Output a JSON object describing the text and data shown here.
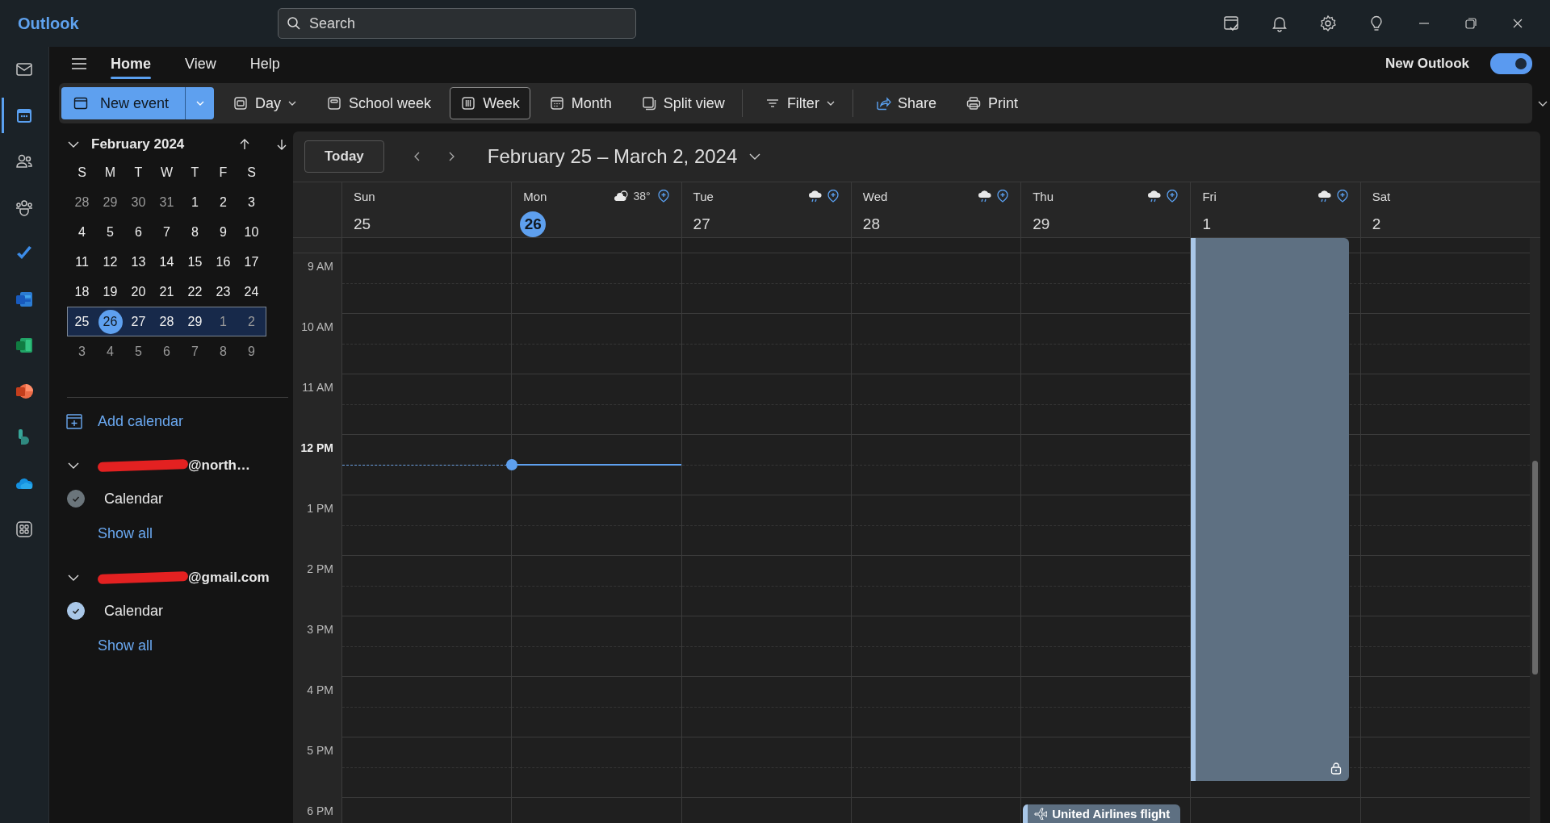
{
  "app": {
    "name": "Outlook"
  },
  "search": {
    "placeholder": "Search"
  },
  "rail": [
    {
      "selected": false
    },
    {
      "selected": true
    },
    {
      "selected": false
    },
    {
      "selected": false
    },
    {
      "selected": false
    },
    {
      "selected": false
    },
    {
      "selected": false
    },
    {
      "selected": false
    },
    {
      "selected": false
    },
    {
      "selected": false
    },
    {
      "selected": false
    }
  ],
  "tabs": [
    {
      "label": "Home",
      "selected": true
    },
    {
      "label": "View",
      "selected": false
    },
    {
      "label": "Help",
      "selected": false
    }
  ],
  "new_outlook": {
    "label": "New Outlook",
    "on": true
  },
  "toolbar": [
    {
      "label": "New event",
      "kind": "split"
    },
    {
      "label": "Day",
      "kind": "dropdown",
      "selected": false
    },
    {
      "label": "School week",
      "kind": "plain",
      "selected": false
    },
    {
      "label": "Week",
      "kind": "plain",
      "selected": true
    },
    {
      "label": "Month",
      "kind": "plain",
      "selected": false
    },
    {
      "label": "Split view",
      "kind": "plain",
      "selected": false
    },
    {
      "kind": "divider"
    },
    {
      "label": "Filter",
      "kind": "dropdown",
      "selected": false
    },
    {
      "kind": "divider"
    },
    {
      "label": "Share",
      "kind": "plain",
      "selected": false
    },
    {
      "label": "Print",
      "kind": "plain",
      "selected": false
    }
  ],
  "mini_calendar": {
    "title": "February 2024",
    "expanded": true,
    "weekdays": [
      "S",
      "M",
      "T",
      "W",
      "T",
      "F",
      "S"
    ],
    "weeks": [
      {
        "selected": false,
        "days": [
          {
            "label": "28",
            "other_month": true,
            "selected": false
          },
          {
            "label": "29",
            "other_month": true,
            "selected": false
          },
          {
            "label": "30",
            "other_month": true,
            "selected": false
          },
          {
            "label": "31",
            "other_month": true,
            "selected": false
          },
          {
            "label": "1",
            "other_month": false,
            "selected": false
          },
          {
            "label": "2",
            "other_month": false,
            "selected": false
          },
          {
            "label": "3",
            "other_month": false,
            "selected": false
          }
        ]
      },
      {
        "selected": false,
        "days": [
          {
            "label": "4",
            "other_month": false,
            "selected": false
          },
          {
            "label": "5",
            "other_month": false,
            "selected": false
          },
          {
            "label": "6",
            "other_month": false,
            "selected": false
          },
          {
            "label": "7",
            "other_month": false,
            "selected": false
          },
          {
            "label": "8",
            "other_month": false,
            "selected": false
          },
          {
            "label": "9",
            "other_month": false,
            "selected": false
          },
          {
            "label": "10",
            "other_month": false,
            "selected": false
          }
        ]
      },
      {
        "selected": false,
        "days": [
          {
            "label": "11",
            "other_month": false,
            "selected": false
          },
          {
            "label": "12",
            "other_month": false,
            "selected": false
          },
          {
            "label": "13",
            "other_month": false,
            "selected": false
          },
          {
            "label": "14",
            "other_month": false,
            "selected": false
          },
          {
            "label": "15",
            "other_month": false,
            "selected": false
          },
          {
            "label": "16",
            "other_month": false,
            "selected": false
          },
          {
            "label": "17",
            "other_month": false,
            "selected": false
          }
        ]
      },
      {
        "selected": false,
        "days": [
          {
            "label": "18",
            "other_month": false,
            "selected": false
          },
          {
            "label": "19",
            "other_month": false,
            "selected": false
          },
          {
            "label": "20",
            "other_month": false,
            "selected": false
          },
          {
            "label": "21",
            "other_month": false,
            "selected": false
          },
          {
            "label": "22",
            "other_month": false,
            "selected": false
          },
          {
            "label": "23",
            "other_month": false,
            "selected": false
          },
          {
            "label": "24",
            "other_month": false,
            "selected": false
          }
        ]
      },
      {
        "selected": true,
        "days": [
          {
            "label": "25",
            "other_month": false,
            "selected": false
          },
          {
            "label": "26",
            "other_month": false,
            "selected": true
          },
          {
            "label": "27",
            "other_month": false,
            "selected": false
          },
          {
            "label": "28",
            "other_month": false,
            "selected": false
          },
          {
            "label": "29",
            "other_month": false,
            "selected": false
          },
          {
            "label": "1",
            "other_month": true,
            "selected": false
          },
          {
            "label": "2",
            "other_month": true,
            "selected": false
          }
        ]
      },
      {
        "selected": false,
        "days": [
          {
            "label": "3",
            "other_month": true,
            "selected": false
          },
          {
            "label": "4",
            "other_month": true,
            "selected": false
          },
          {
            "label": "5",
            "other_month": true,
            "selected": false
          },
          {
            "label": "6",
            "other_month": true,
            "selected": false
          },
          {
            "label": "7",
            "other_month": true,
            "selected": false
          },
          {
            "label": "8",
            "other_month": true,
            "selected": false
          },
          {
            "label": "9",
            "other_month": true,
            "selected": false
          }
        ]
      }
    ]
  },
  "add_calendar": "Add calendar",
  "accounts": [
    {
      "name": "@north…",
      "redacted": true,
      "expanded": true,
      "calendars": [
        {
          "name": "Calendar",
          "checked": true,
          "color": "#6b757b"
        }
      ],
      "show_all": "Show all"
    },
    {
      "name": "@gmail.com",
      "redacted": true,
      "expanded": true,
      "calendars": [
        {
          "name": "Calendar",
          "checked": true,
          "color": "#a9c7e8"
        }
      ],
      "show_all": "Show all"
    }
  ],
  "calendar": {
    "today_button": "Today",
    "range_title": "February 25 – March 2, 2024",
    "days": [
      {
        "weekday": "Sun",
        "date": "25",
        "today": false
      },
      {
        "weekday": "Mon",
        "date": "26",
        "today": true,
        "forecast": {
          "kind": "sun-cloud",
          "temperature": "38°"
        }
      },
      {
        "weekday": "Tue",
        "date": "27",
        "today": false,
        "forecast": {
          "kind": "rain"
        }
      },
      {
        "weekday": "Wed",
        "date": "28",
        "today": false,
        "forecast": {
          "kind": "rain"
        }
      },
      {
        "weekday": "Thu",
        "date": "29",
        "today": false,
        "forecast": {
          "kind": "rain"
        },
        "events": [
          {
            "kind": "flight",
            "title": "United Airlines flight",
            "private": false
          }
        ]
      },
      {
        "weekday": "Fri",
        "date": "1",
        "today": false,
        "forecast": {
          "kind": "rain"
        },
        "events": [
          {
            "kind": "busy",
            "private": true
          }
        ]
      },
      {
        "weekday": "Sat",
        "date": "2",
        "today": false
      }
    ],
    "hours": [
      {
        "label": "9 AM",
        "current": false
      },
      {
        "label": "10 AM",
        "current": false
      },
      {
        "label": "11 AM",
        "current": false
      },
      {
        "label": "12 PM",
        "current": true
      },
      {
        "label": "1 PM",
        "current": false
      },
      {
        "label": "2 PM",
        "current": false
      },
      {
        "label": "3 PM",
        "current": false
      },
      {
        "label": "4 PM",
        "current": false
      },
      {
        "label": "5 PM",
        "current": false
      },
      {
        "label": "6 PM",
        "current": false
      }
    ]
  }
}
